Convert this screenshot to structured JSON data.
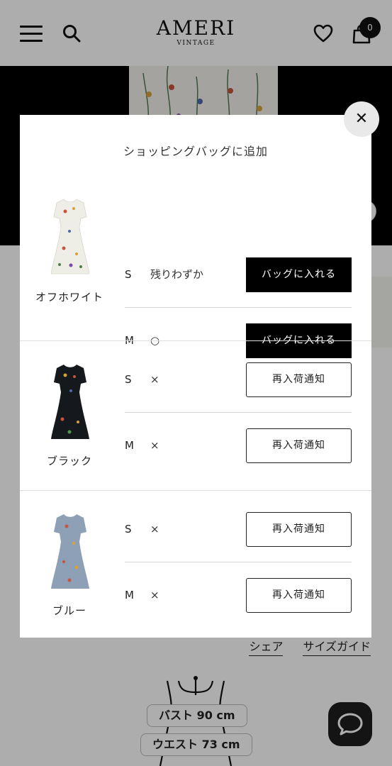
{
  "header": {
    "logo_main": "AMERI",
    "logo_sub": "VINTAGE",
    "cart_count": "0"
  },
  "page": {
    "share_link": "シェア",
    "size_guide_link": "サイズガイド",
    "bust_label": "バスト 90 cm",
    "waist_label": "ウエスト 73 cm"
  },
  "modal": {
    "title": "ショッピングバッグに追加",
    "close_symbol": "✕",
    "groups": [
      {
        "color": "オフホワイト",
        "rows": [
          {
            "size": "S",
            "stock": "残りわずか",
            "button": "バッグに入れる"
          },
          {
            "size": "M",
            "stock": "○",
            "button": "バッグに入れる"
          }
        ]
      },
      {
        "color": "ブラック",
        "rows": [
          {
            "size": "S",
            "stock": "×",
            "button": "再入荷通知"
          },
          {
            "size": "M",
            "stock": "×",
            "button": "再入荷通知"
          }
        ]
      },
      {
        "color": "ブルー",
        "rows": [
          {
            "size": "S",
            "stock": "×",
            "button": "再入荷通知"
          },
          {
            "size": "M",
            "stock": "×",
            "button": "再入荷通知"
          }
        ]
      }
    ]
  },
  "colors": {
    "primary_button": "#000000",
    "overlay": "rgba(0,0,0,0.32)",
    "dress_offwhite": "#efeee6",
    "dress_black": "#15181c",
    "dress_blue": "#8da0b6"
  }
}
